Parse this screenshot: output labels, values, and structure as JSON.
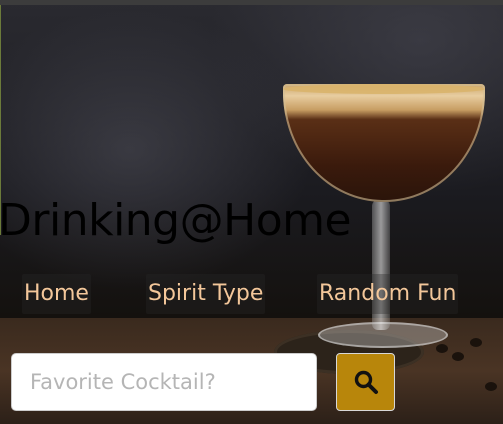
{
  "header": {
    "title": "Drinking@Home"
  },
  "nav": {
    "items": [
      {
        "label": "Home"
      },
      {
        "label": "Spirit Type"
      },
      {
        "label": "Random Fun"
      }
    ]
  },
  "search": {
    "placeholder": "Favorite Cocktail?",
    "value": "",
    "button_icon": "search-icon"
  },
  "colors": {
    "nav_text": "#f3c79a",
    "button_bg": "#b8860b",
    "title_text": "#000000"
  }
}
